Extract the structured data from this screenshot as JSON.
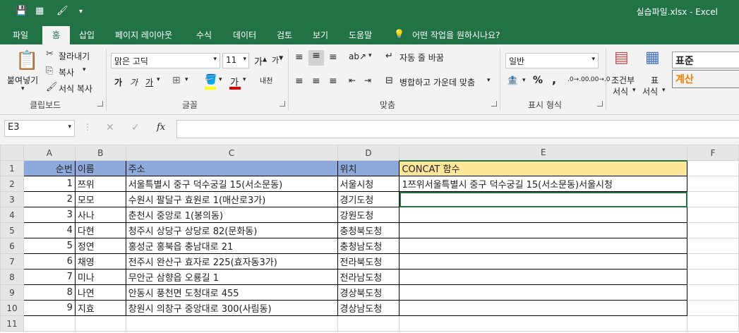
{
  "window": {
    "title": "실습파일.xlsx  -  Excel",
    "quick_access": [
      "save-icon",
      "table-icon",
      "brush-icon",
      "more-icon"
    ]
  },
  "tabs": [
    "파일",
    "홈",
    "삽입",
    "페이지 레이아웃",
    "수식",
    "데이터",
    "검토",
    "보기",
    "도움말"
  ],
  "tell_me": "어떤 작업을 원하시나요?",
  "clipboard": {
    "paste": "붙여넣기",
    "cut": "잘라내기",
    "copy": "복사",
    "format_painter": "서식 복사",
    "group": "클립보드"
  },
  "font": {
    "name": "맑은 고딕",
    "size": "11",
    "bold": "가",
    "italic": "가",
    "underline": "가",
    "font_color": "가",
    "phonetic": "내천",
    "group": "글꼴"
  },
  "alignment": {
    "wrap": "자동 줄 바꿈",
    "merge": "병합하고 가운데 맞춤",
    "group": "맞춤"
  },
  "number": {
    "format": "일반",
    "percent": "%",
    "comma": ",",
    "group": "표시 형식"
  },
  "styles": {
    "conditional_line1": "조건부",
    "conditional_line2": "서식",
    "table_line1": "표",
    "table_line2": "서식",
    "normal": "표준",
    "calc": "계산"
  },
  "formula_bar": {
    "name_box": "E3",
    "cancel": "✕",
    "enter": "✓",
    "fx": "fx",
    "content": ""
  },
  "colors": {
    "excel_green": "#217346",
    "header_blue": "#8ea9db",
    "header_yellow": "#ffe699",
    "calc_orange": "#fa7d00"
  },
  "sheet": {
    "columns": [
      "A",
      "B",
      "C",
      "D",
      "E",
      "F"
    ],
    "row_numbers": [
      "1",
      "2",
      "3",
      "4",
      "5",
      "6",
      "7",
      "8",
      "9",
      "10",
      "11"
    ],
    "header": [
      "순번",
      "이름",
      "주소",
      "위치",
      "CONCAT 함수"
    ],
    "rows": [
      [
        "1",
        "쯔위",
        "서울특별시 중구 덕수궁길 15(서소문동)",
        "서울시청",
        "1쯔위서울특별시 중구 덕수궁길 15(서소문동)서울시청"
      ],
      [
        "2",
        "모모",
        "수원시 팔달구 효원로 1(매산로3가)",
        "경기도청",
        ""
      ],
      [
        "3",
        "사나",
        "춘천시 중앙로 1(봉의동)",
        "강원도청",
        ""
      ],
      [
        "4",
        "다현",
        "청주시 상당구 상당로 82(문화동)",
        "충청북도청",
        ""
      ],
      [
        "5",
        "정연",
        "홍성군 홍북읍 충남대로 21",
        "충청남도청",
        ""
      ],
      [
        "6",
        "채영",
        "전주시 완산구 효자로 225(효자동3가)",
        "전라북도청",
        ""
      ],
      [
        "7",
        "미나",
        "무안군 삼향읍 오룡길 1",
        "전라남도청",
        ""
      ],
      [
        "8",
        "나연",
        "안동시 풍천면 도청대로 455",
        "경상북도청",
        ""
      ],
      [
        "9",
        "지효",
        "창원시 의창구 중앙대로 300(사림동)",
        "경상남도청",
        ""
      ]
    ]
  }
}
